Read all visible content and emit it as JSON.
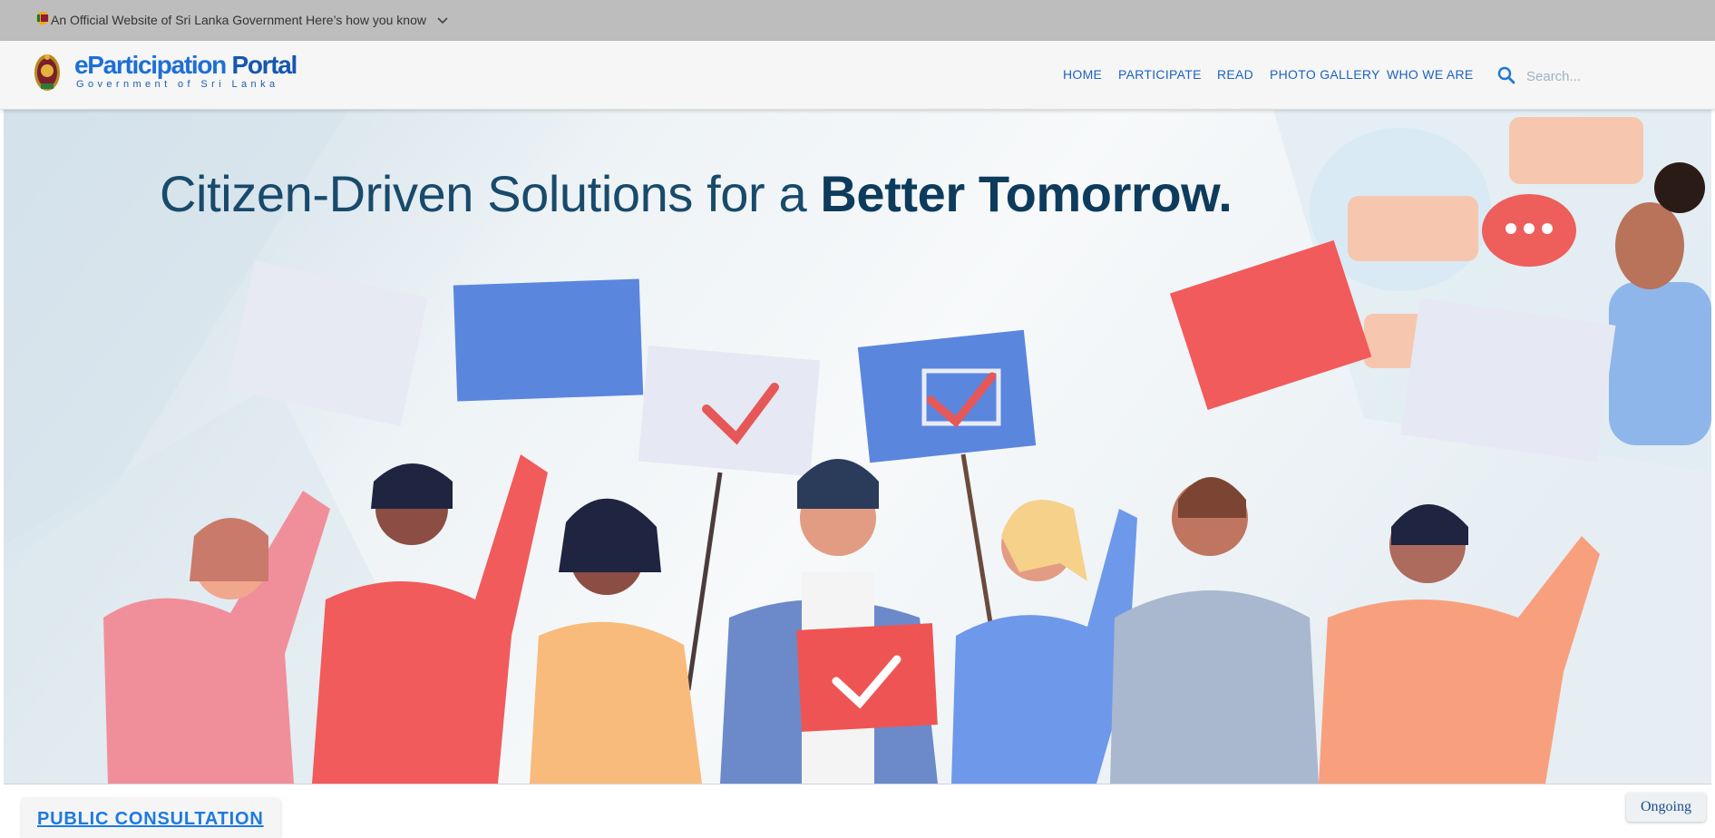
{
  "banner": {
    "text": "An Official Website of Sri Lanka Government Here’s how you know"
  },
  "header": {
    "brand_e": "eParticipation",
    "brand_portal": " Portal",
    "brand_sub": "Government of Sri Lanka"
  },
  "nav": {
    "home": "HOME",
    "participate": "PARTICIPATE",
    "read": "READ",
    "photo_gallery": "PHOTO GALLERY",
    "who_we_are": "WHO WE ARE"
  },
  "search": {
    "placeholder": "Search..."
  },
  "hero": {
    "headline_regular": "Citizen-Driven Solutions for a ",
    "headline_bold": "Better Tomorrow."
  },
  "section": {
    "public_consultation": "PUBLIC CONSULTATION",
    "ongoing": "Ongoing"
  },
  "colors": {
    "nav_link": "#1e63c0",
    "brand_blue": "#1d6fd6",
    "headline": "#184a6b",
    "banner_bg": "#bdbdbd",
    "sign_blue": "#5b86de",
    "sign_red": "#ef5b5b"
  },
  "icons": {
    "flag": "sri-lanka-flag-icon",
    "chevron": "chevron-down-icon",
    "emblem": "sri-lanka-emblem-icon",
    "search": "search-icon"
  }
}
